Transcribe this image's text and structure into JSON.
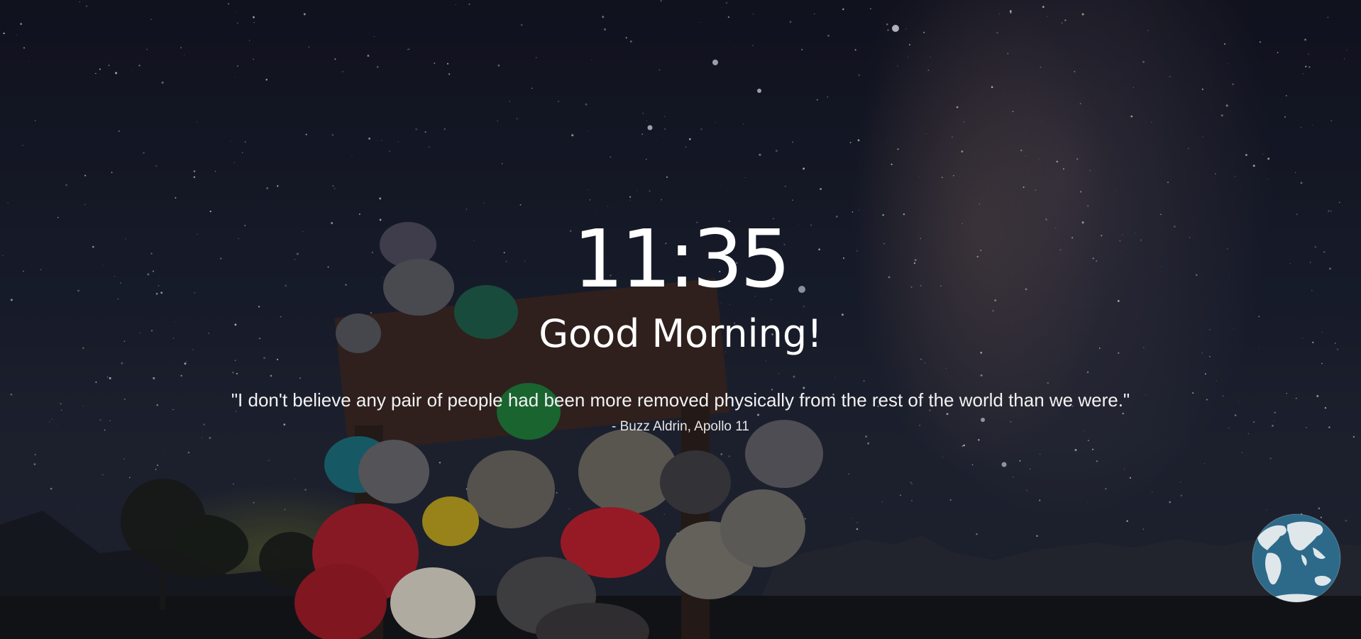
{
  "clock": {
    "time": "11:35"
  },
  "greeting": {
    "text": "Good Morning!"
  },
  "quote": {
    "text": "\"I don't believe any pair of people had been more removed physically from the rest of the world than we were.\"",
    "author": "- Buzz Aldrin, Apollo 11"
  },
  "globe": {
    "icon": "globe-icon"
  },
  "background": {
    "subject": "night-sky-milky-way-teakettle-junction",
    "palette": [
      "#141625",
      "#232838",
      "#8a6b60",
      "#a51f2e",
      "#2aa198"
    ]
  }
}
